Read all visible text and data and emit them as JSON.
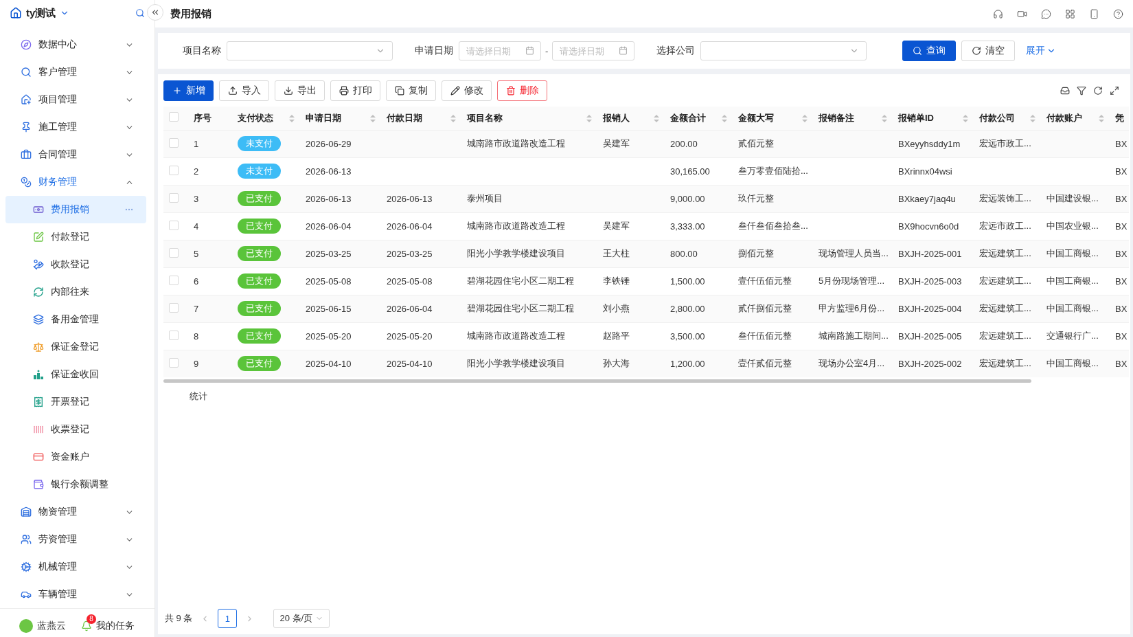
{
  "brand": {
    "name": "ty测试"
  },
  "nav": [
    {
      "label": "数据中心",
      "expanded": false
    },
    {
      "label": "客户管理",
      "expanded": false
    },
    {
      "label": "项目管理",
      "expanded": false
    },
    {
      "label": "施工管理",
      "expanded": false
    },
    {
      "label": "合同管理",
      "expanded": false
    },
    {
      "label": "财务管理",
      "expanded": true,
      "children": [
        {
          "label": "费用报销",
          "selected": true
        },
        {
          "label": "付款登记",
          "selected": false
        },
        {
          "label": "收款登记",
          "selected": false
        },
        {
          "label": "内部往来",
          "selected": false
        },
        {
          "label": "备用金管理",
          "selected": false
        },
        {
          "label": "保证金登记",
          "selected": false
        },
        {
          "label": "保证金收回",
          "selected": false
        },
        {
          "label": "开票登记",
          "selected": false
        },
        {
          "label": "收票登记",
          "selected": false
        },
        {
          "label": "资金账户",
          "selected": false
        },
        {
          "label": "银行余额调整",
          "selected": false
        }
      ]
    },
    {
      "label": "物资管理",
      "expanded": false
    },
    {
      "label": "劳资管理",
      "expanded": false
    },
    {
      "label": "机械管理",
      "expanded": false
    },
    {
      "label": "车辆管理",
      "expanded": false
    }
  ],
  "sidebar_footer": {
    "app_label": "蓝燕云",
    "tasks_label": "我的任务",
    "tasks_badge": "8"
  },
  "page": {
    "title": "费用报销"
  },
  "filters": {
    "project_label": "项目名称",
    "date_label": "申请日期",
    "date_start_placeholder": "请选择日期",
    "date_separator": "-",
    "date_end_placeholder": "请选择日期",
    "company_label": "选择公司",
    "query_button": "查询",
    "clear_button": "清空",
    "expand_link": "展开"
  },
  "toolbar": [
    {
      "label": "新增",
      "kind": "primary"
    },
    {
      "label": "导入",
      "kind": "default"
    },
    {
      "label": "导出",
      "kind": "default"
    },
    {
      "label": "打印",
      "kind": "default"
    },
    {
      "label": "复制",
      "kind": "default"
    },
    {
      "label": "修改",
      "kind": "default"
    },
    {
      "label": "删除",
      "kind": "danger"
    }
  ],
  "table": {
    "all_checked": false,
    "columns": [
      {
        "label": "序号",
        "sortable": false
      },
      {
        "label": "支付状态",
        "sortable": true
      },
      {
        "label": "申请日期",
        "sortable": true
      },
      {
        "label": "付款日期",
        "sortable": true
      },
      {
        "label": "项目名称",
        "sortable": true
      },
      {
        "label": "报销人",
        "sortable": true
      },
      {
        "label": "金额合计",
        "sortable": true
      },
      {
        "label": "金额大写",
        "sortable": true
      },
      {
        "label": "报销备注",
        "sortable": true
      },
      {
        "label": "报销单ID",
        "sortable": true
      },
      {
        "label": "付款公司",
        "sortable": true
      },
      {
        "label": "付款账户",
        "sortable": true
      },
      {
        "label": "凭",
        "sortable": false
      }
    ],
    "rows": [
      {
        "checked": false,
        "index": "1",
        "status": "未支付",
        "color": "#3dbcf6",
        "apply_date": "2026-06-29",
        "project": "城南路市政道路改造工程",
        "applicant": "吴建军",
        "amount": "200.00",
        "amount_words": "贰佰元整",
        "claim_id": "BXeyyhsddy1m",
        "company": "宏远市政工...",
        "column_13": "BX"
      },
      {
        "checked": false,
        "index": "2",
        "status": "未支付",
        "color": "#3dbcf6",
        "apply_date": "2026-06-13",
        "amount": "30,165.00",
        "amount_words": "叁万零壹佰陆拾...",
        "claim_id": "BXrinnx04wsi",
        "column_13": "BX"
      },
      {
        "checked": false,
        "index": "3",
        "status": "已支付",
        "color": "#5ac43a",
        "apply_date": "2026-06-13",
        "pay_date": "2026-06-13",
        "project": "泰州项目",
        "amount": "9,000.00",
        "amount_words": "玖仟元整",
        "claim_id": "BXkaey7jaq4u",
        "company": "宏远装饰工...",
        "account": "中国建设银...",
        "column_13": "BX"
      },
      {
        "checked": false,
        "index": "4",
        "status": "已支付",
        "color": "#5ac43a",
        "apply_date": "2026-06-04",
        "pay_date": "2026-06-04",
        "project": "城南路市政道路改造工程",
        "applicant": "吴建军",
        "amount": "3,333.00",
        "amount_words": "叁仟叁佰叁拾叁...",
        "claim_id": "BX9hocvn6o0d",
        "company": "宏远市政工...",
        "account": "中国农业银...",
        "column_13": "BX"
      },
      {
        "checked": false,
        "index": "5",
        "status": "已支付",
        "color": "#5ac43a",
        "apply_date": "2025-03-25",
        "pay_date": "2025-03-25",
        "project": "阳光小学教学楼建设项目",
        "applicant": "王大柱",
        "amount": "800.00",
        "amount_words": "捌佰元整",
        "note": "现场管理人员当...",
        "claim_id": "BXJH-2025-001",
        "company": "宏远建筑工...",
        "account": "中国工商银...",
        "column_13": "BX"
      },
      {
        "checked": false,
        "index": "6",
        "status": "已支付",
        "color": "#5ac43a",
        "apply_date": "2025-05-08",
        "pay_date": "2025-05-08",
        "project": "碧湖花园住宅小区二期工程",
        "applicant": "李铁锤",
        "amount": "1,500.00",
        "amount_words": "壹仟伍佰元整",
        "note": "5月份现场管理...",
        "claim_id": "BXJH-2025-003",
        "company": "宏远建筑工...",
        "account": "中国工商银...",
        "column_13": "BX"
      },
      {
        "checked": false,
        "index": "7",
        "status": "已支付",
        "color": "#5ac43a",
        "apply_date": "2025-06-15",
        "pay_date": "2026-06-04",
        "project": "碧湖花园住宅小区二期工程",
        "applicant": "刘小燕",
        "amount": "2,800.00",
        "amount_words": "贰仟捌佰元整",
        "note": "甲方监理6月份...",
        "claim_id": "BXJH-2025-004",
        "company": "宏远建筑工...",
        "account": "中国工商银...",
        "column_13": "BX"
      },
      {
        "checked": false,
        "index": "8",
        "status": "已支付",
        "color": "#5ac43a",
        "apply_date": "2025-05-20",
        "pay_date": "2025-05-20",
        "project": "城南路市政道路改造工程",
        "applicant": "赵路平",
        "amount": "3,500.00",
        "amount_words": "叁仟伍佰元整",
        "note": "城南路施工期间...",
        "claim_id": "BXJH-2025-005",
        "company": "宏远建筑工...",
        "account": "交通银行广...",
        "column_13": "BX"
      },
      {
        "checked": false,
        "index": "9",
        "status": "已支付",
        "color": "#5ac43a",
        "apply_date": "2025-04-10",
        "pay_date": "2025-04-10",
        "project": "阳光小学教学楼建设项目",
        "applicant": "孙大海",
        "amount": "1,200.00",
        "amount_words": "壹仟贰佰元整",
        "note": "现场办公室4月...",
        "claim_id": "BXJH-2025-002",
        "company": "宏远建筑工...",
        "account": "中国工商银...",
        "column_13": "BX"
      }
    ],
    "summary_label": "统计"
  },
  "pagination": {
    "total": "共 9 条",
    "pages": [
      {
        "label": "1",
        "selected": true
      }
    ],
    "page_size": "20 条/页"
  }
}
